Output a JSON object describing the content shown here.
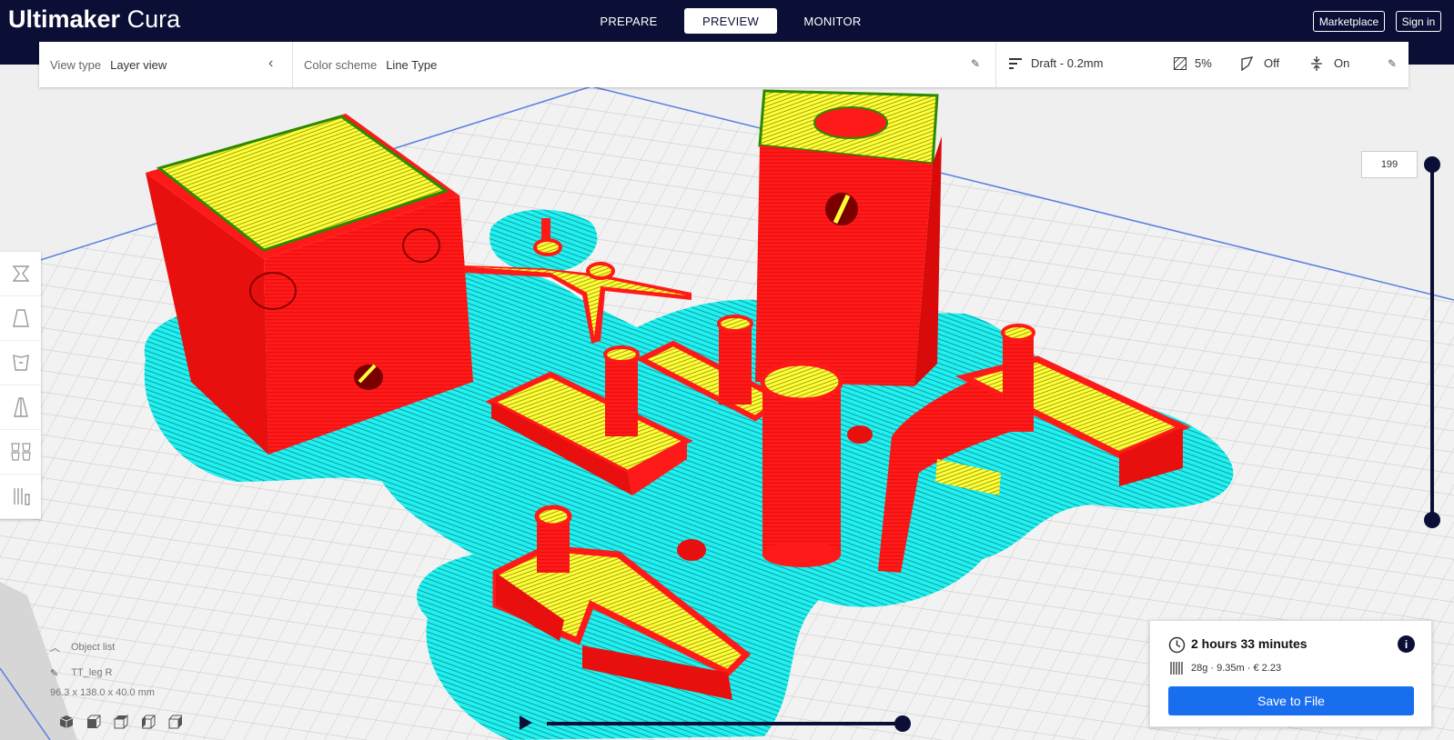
{
  "app": {
    "brand_bold": "Ultimaker",
    "brand_light": "Cura"
  },
  "stages": [
    {
      "label": "PREPARE",
      "active": false
    },
    {
      "label": "PREVIEW",
      "active": true
    },
    {
      "label": "MONITOR",
      "active": false
    }
  ],
  "header": {
    "marketplace": "Marketplace",
    "signin": "Sign in"
  },
  "settings": {
    "view_type_label": "View type",
    "view_type_value": "Layer view",
    "color_scheme_label": "Color scheme",
    "color_scheme_value": "Line Type",
    "profile": "Draft - 0.2mm",
    "infill": "5%",
    "support": "Off",
    "adhesion": "On"
  },
  "layer_slider": {
    "current": "199"
  },
  "object_list": {
    "toggle_label": "Object list",
    "object_name": "TT_leg R",
    "dimensions": "96.3 x 138.0 x 40.0 mm"
  },
  "print_info": {
    "time": "2 hours 33 minutes",
    "usage": "28g · 9.35m · € 2.23",
    "save_label": "Save to File"
  },
  "colors": {
    "header": "#0b0f36",
    "wall": "#ff1a1a",
    "skin": "#ffff3a",
    "skirt": "#22f0f0",
    "accent": "#196ef0"
  }
}
